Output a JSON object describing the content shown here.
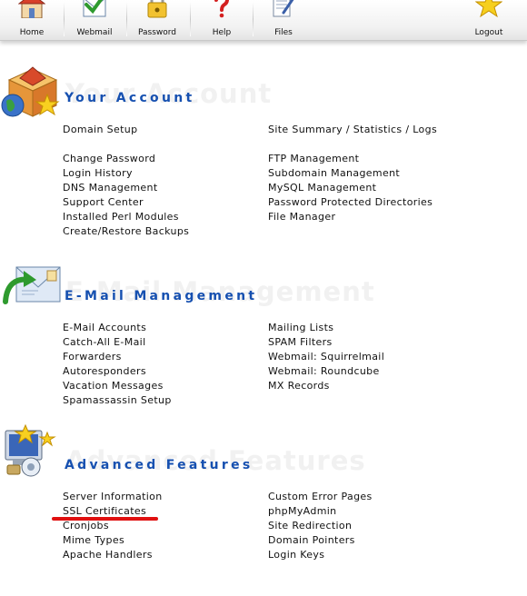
{
  "nav": {
    "home": "Home",
    "webmail": "Webmail",
    "password": "Password",
    "help": "Help",
    "files": "Files",
    "logout": "Logout"
  },
  "sections": {
    "account": {
      "title": "Your Account",
      "links": [
        "Domain Setup",
        "Site Summary / Statistics / Logs",
        "Change Password",
        "Login History",
        "DNS Management",
        "Support Center",
        "Installed Perl Modules",
        "Create/Restore Backups",
        "FTP Management",
        "Subdomain Management",
        "MySQL Management",
        "Password Protected Directories",
        "File Manager"
      ]
    },
    "email": {
      "title": "E-Mail Management",
      "links": [
        "E-Mail Accounts",
        "Catch-All E-Mail",
        "Forwarders",
        "Autoresponders",
        "Vacation Messages",
        "Spamassassin Setup",
        "Mailing Lists",
        "SPAM Filters",
        "Webmail: Squirrelmail",
        "Webmail: Roundcube",
        "MX Records"
      ]
    },
    "advanced": {
      "title": "Advanced Features",
      "links": [
        "Server Information",
        "SSL Certificates",
        "Cronjobs",
        "Mime Types",
        "Apache Handlers",
        "Custom Error Pages",
        "phpMyAdmin",
        "Site Redirection",
        "Domain Pointers",
        "Login Keys"
      ]
    }
  },
  "icons": {
    "home": "house-icon",
    "webmail": "envelope-check-icon",
    "password": "padlock-icon",
    "help": "question-mark-icon",
    "files": "document-pen-icon",
    "logout": "star-icon"
  },
  "colors": {
    "section_title": "#1650b0",
    "highlight_underline": "#e01010"
  }
}
